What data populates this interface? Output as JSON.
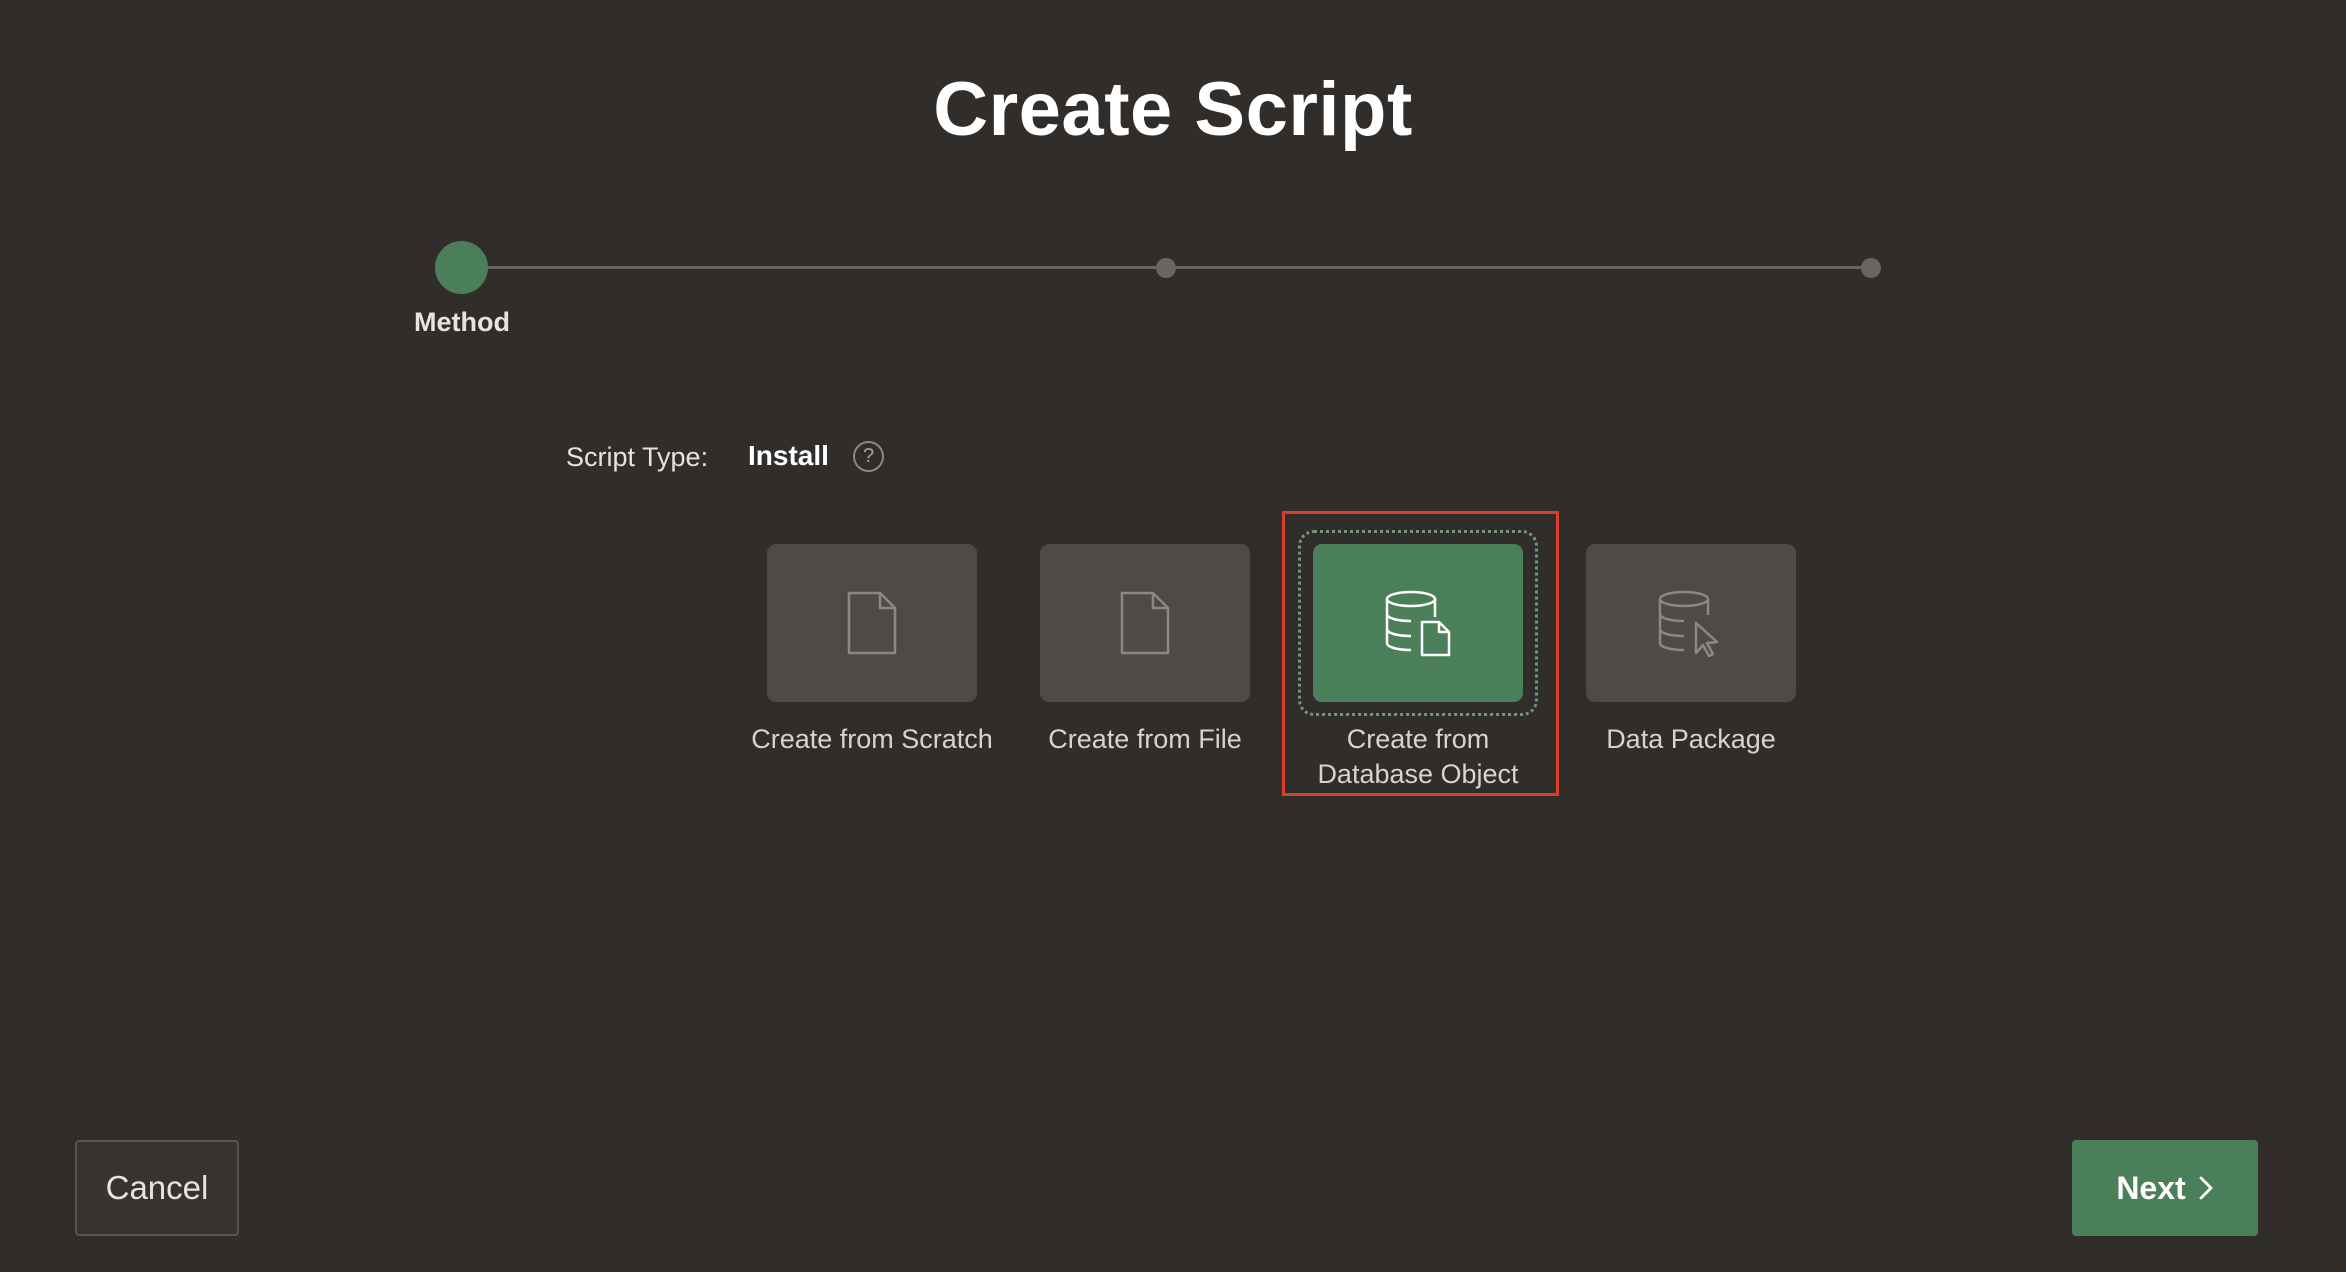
{
  "dialog": {
    "title": "Create Script"
  },
  "train": {
    "current_step_label": "Method",
    "total_steps": 3,
    "current_step": 1
  },
  "script_type": {
    "label": "Script Type:",
    "value": "Install",
    "help_icon": "help-circle-icon",
    "help_glyph": "?"
  },
  "options": [
    {
      "label": "Create from Scratch",
      "icon": "document-icon",
      "selected": false
    },
    {
      "label": "Create from File",
      "icon": "document-icon",
      "selected": false
    },
    {
      "label": "Create from Database Object",
      "icon": "database-document-icon",
      "selected": true
    },
    {
      "label": "Data Package",
      "icon": "database-cursor-icon",
      "selected": false
    }
  ],
  "footer": {
    "cancel_label": "Cancel",
    "next_label": "Next",
    "next_icon": "chevron-right-icon"
  },
  "colors": {
    "background": "#312d2a",
    "accent": "#4b7f5a",
    "highlight": "#d8402d"
  }
}
